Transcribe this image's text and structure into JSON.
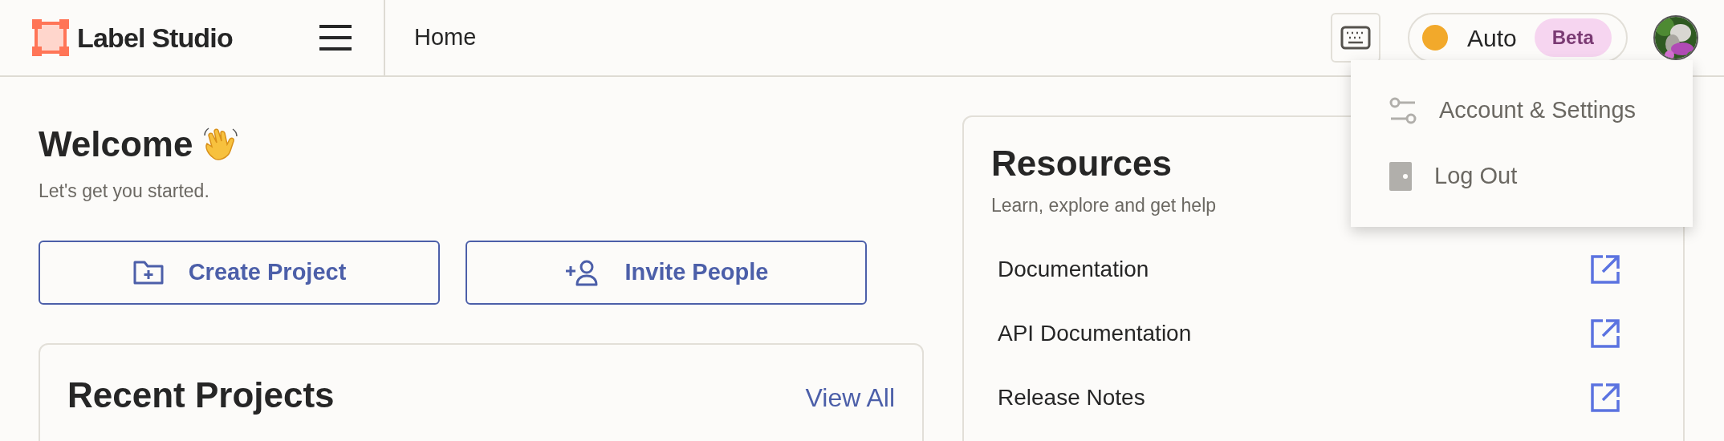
{
  "header": {
    "brand": "Label Studio",
    "breadcrumb": "Home",
    "theme": {
      "label": "Auto",
      "badge": "Beta"
    }
  },
  "user_menu": {
    "items": [
      {
        "kind": "settings",
        "label": "Account & Settings"
      },
      {
        "kind": "logout",
        "label": "Log Out"
      }
    ]
  },
  "welcome": {
    "title": "Welcome",
    "subtitle": "Let's get you started.",
    "actions": [
      {
        "kind": "create",
        "label": "Create Project"
      },
      {
        "kind": "invite",
        "label": "Invite People"
      }
    ]
  },
  "recent_projects": {
    "title": "Recent Projects",
    "link": "View All"
  },
  "resources": {
    "title": "Resources",
    "subtitle": "Learn, explore and get help",
    "links": [
      "Documentation",
      "API Documentation",
      "Release Notes"
    ]
  }
}
